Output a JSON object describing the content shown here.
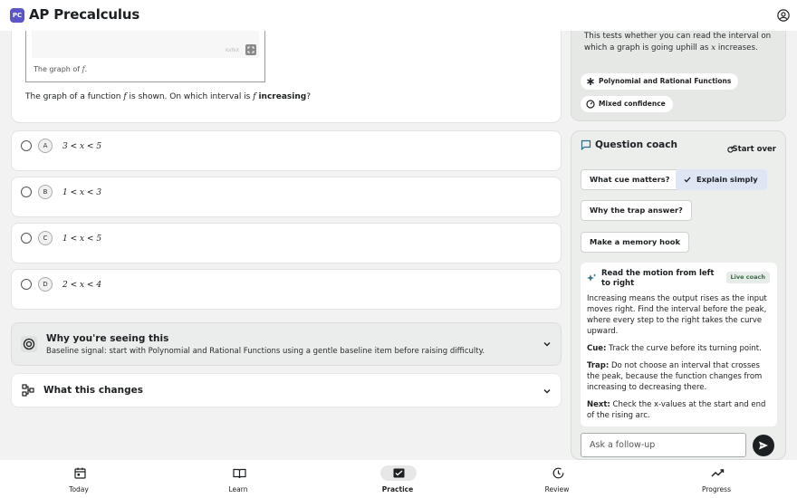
{
  "app": {
    "logo": "PC",
    "title": "AP Precalculus"
  },
  "question": {
    "graph_caption_prefix": "The graph of ",
    "fn": "f",
    "graph_caption_suffix": ".",
    "watermark": "KaTeX",
    "stem_prefix": "The graph of a function ",
    "stem_mid": " is shown. On which interval is ",
    "stem_bold": "increasing",
    "stem_suffix": "?"
  },
  "options": [
    {
      "letter": "A",
      "text": "3 < x < 5"
    },
    {
      "letter": "B",
      "text": "1 < x < 3"
    },
    {
      "letter": "C",
      "text": "1 < x < 5"
    },
    {
      "letter": "D",
      "text": "2 < x < 4"
    }
  ],
  "why": {
    "title": "Why you're seeing this",
    "subtitle": "Baseline signal: start with Polynomial and Rational Functions using a gentle baseline item before raising difficulty."
  },
  "changes": {
    "title": "What this changes"
  },
  "insight": {
    "text_prefix": "This tests whether you can read the interval on which a graph is going uphill as ",
    "var": "x",
    "text_suffix": " increases.",
    "tags": [
      "Polynomial and Rational Functions",
      "Mixed confidence"
    ]
  },
  "coach": {
    "title": "Question coach",
    "start_over": "Start over",
    "chips": [
      "What cue matters?",
      "Explain simply",
      "Why the trap answer?",
      "Make a memory hook"
    ],
    "active_chip": "Explain simply",
    "answer_title": "Read the motion from left to right",
    "live_badge": "Live coach",
    "body": "Increasing means the output rises as the input moves right. Find the interval before the peak, where every step to the right takes the curve upward.",
    "cue_label": "Cue:",
    "cue": "Track the curve before its turning point.",
    "trap_label": "Trap:",
    "trap": "Do not choose an interval that crosses the peak, because the function changes from increasing to decreasing there.",
    "next_label": "Next:",
    "next": "Check the x-values at the start and end of the rising arc.",
    "followup_placeholder": "Ask a follow-up"
  },
  "nav": {
    "items": [
      "Today",
      "Learn",
      "Practice",
      "Review",
      "Progress"
    ],
    "active": "Practice"
  }
}
